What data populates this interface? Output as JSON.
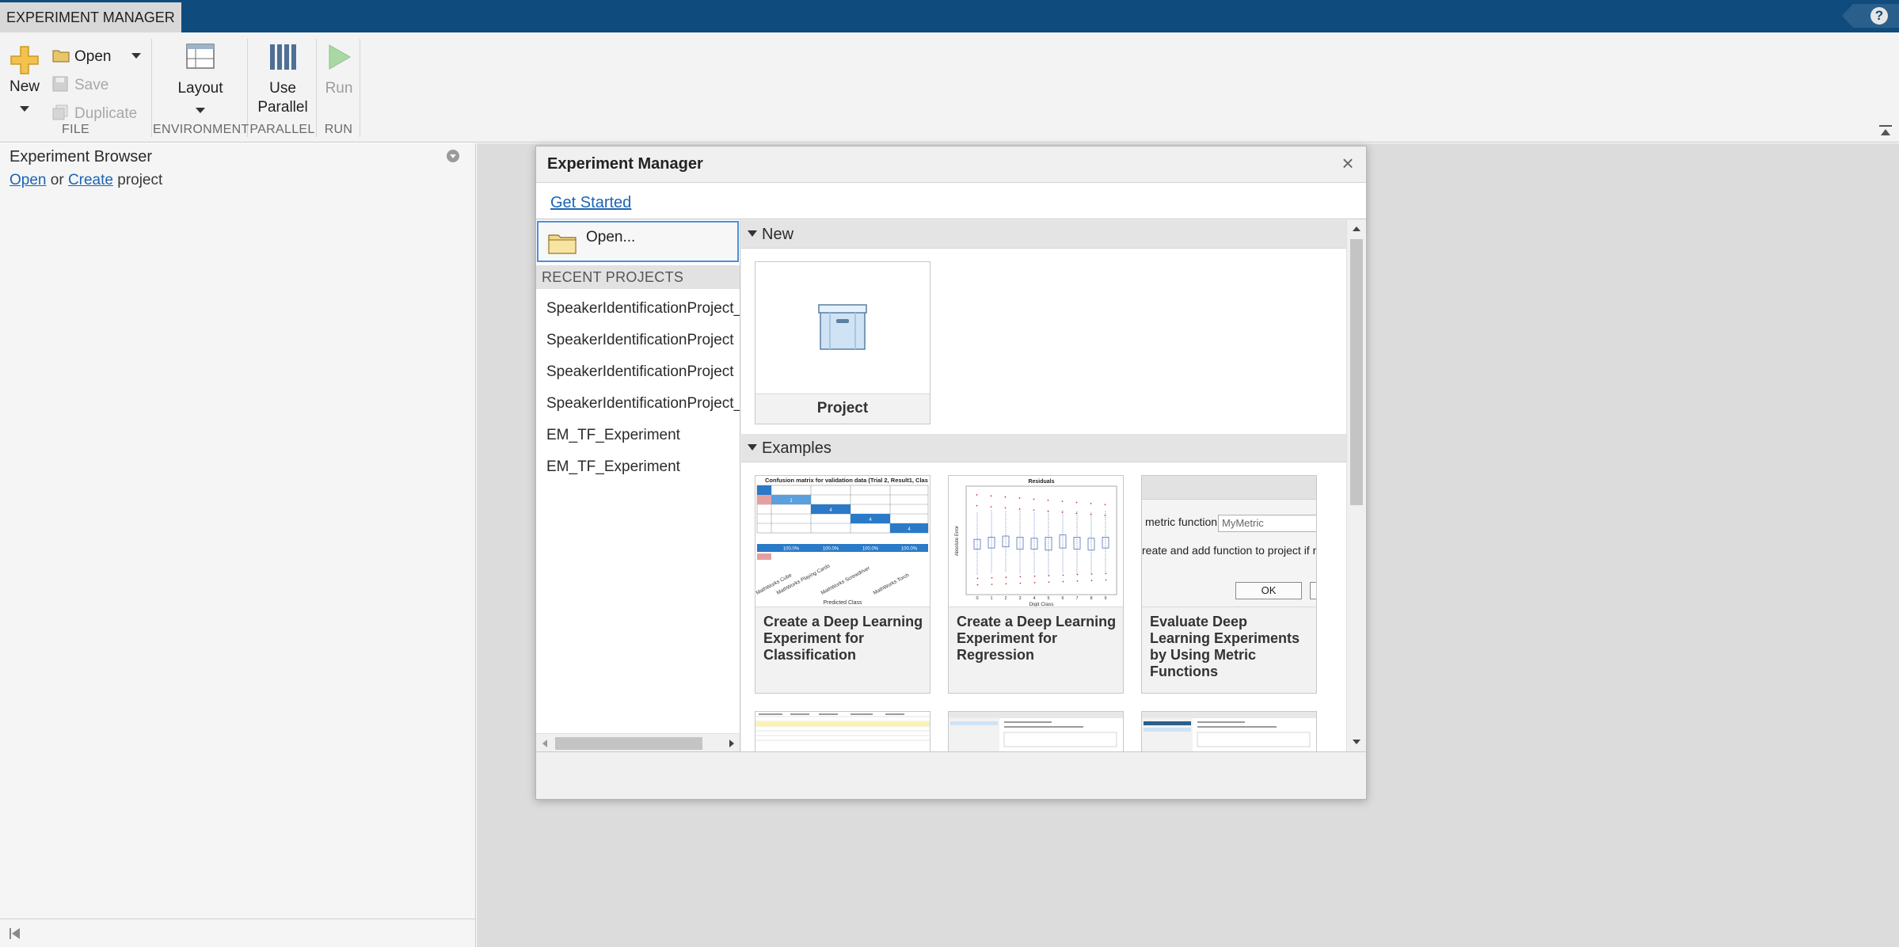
{
  "app": {
    "tab_title": "EXPERIMENT MANAGER",
    "help": "?"
  },
  "toolstrip": {
    "file": {
      "section_label": "FILE",
      "new_label": "New",
      "open_label": "Open",
      "save_label": "Save",
      "duplicate_label": "Duplicate"
    },
    "environment": {
      "section_label": "ENVIRONMENT",
      "layout_label": "Layout"
    },
    "parallel": {
      "section_label": "PARALLEL",
      "use_parallel_line1": "Use",
      "use_parallel_line2": "Parallel"
    },
    "run": {
      "section_label": "RUN",
      "run_label": "Run"
    }
  },
  "browser": {
    "title": "Experiment Browser",
    "open_link": "Open",
    "or_text": " or ",
    "create_link": "Create",
    "project_text": " project"
  },
  "dialog": {
    "title": "Experiment Manager",
    "close": "×",
    "tab_get_started": "Get Started",
    "open_label": "Open...",
    "recent_header": "RECENT PROJECTS",
    "recent_projects": [
      "SpeakerIdentificationProject_te",
      "SpeakerIdentificationProject",
      "SpeakerIdentificationProject",
      "SpeakerIdentificationProject_te",
      "EM_TF_Experiment",
      "EM_TF_Experiment"
    ],
    "new_header": "New",
    "project_card_label": "Project",
    "examples_header": "Examples",
    "examples": [
      {
        "title": "Create a Deep Learning Experiment for Classification"
      },
      {
        "title": "Create a Deep Learning Experiment for Regression"
      },
      {
        "title": "Evaluate Deep Learning Experiments by Using Metric Functions"
      }
    ],
    "thumb_confusion": {
      "title": "Confusion matrix for validation data (Trial 2, Result1, Clas",
      "percent_values": [
        "100.0%",
        "100.0%",
        "100.0%",
        "100.0%"
      ],
      "diag_values": [
        "1",
        "4",
        "4",
        "4"
      ],
      "x_tick_labels": [
        "MathWorks Cube",
        "MathWorks Playing Cards",
        "MathWorks Screwdriver",
        "MathWorks Torch"
      ],
      "xlabel": "Predicted Class"
    },
    "thumb_residuals": {
      "title": "Residuals",
      "xlabel": "Digit Class",
      "ylabel": "Absolute Error",
      "x_ticks": [
        "0",
        "1",
        "2",
        "3",
        "4",
        "5",
        "6",
        "7",
        "8",
        "9"
      ]
    },
    "thumb_metric": {
      "field_label": "metric function",
      "field_value": "MyMetric",
      "checkbox_text": "reate and add function to project if n",
      "ok_label": "OK"
    },
    "colors": {
      "accent": "#1c64b4",
      "titlebar": "#0f4b7d",
      "matrix_blue": "#2a7ac7"
    }
  }
}
